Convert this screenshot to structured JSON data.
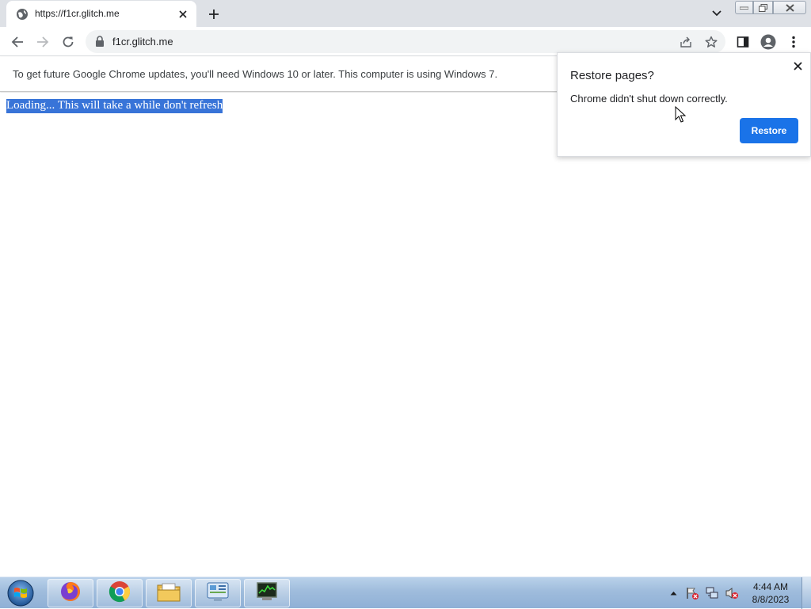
{
  "browser": {
    "tab": {
      "title": "https://f1cr.glitch.me"
    },
    "omnibox": {
      "url": "f1cr.glitch.me"
    }
  },
  "infobar": {
    "message": "To get future Google Chrome updates, you'll need Windows 10 or later. This computer is using Windows 7."
  },
  "page": {
    "loading_text": "Loading... This will take a while don't refresh",
    "selection_color": "#3874d8"
  },
  "restore_bubble": {
    "title": "Restore pages?",
    "message": "Chrome didn't shut down correctly.",
    "button_label": "Restore",
    "accent": "#1a73e8"
  },
  "taskbar": {
    "items": [
      "firefox-icon",
      "chrome-icon",
      "file-explorer-icon",
      "control-panel-icon",
      "task-manager-icon"
    ],
    "clock_time": "4:44 AM",
    "clock_date": "8/8/2023"
  }
}
